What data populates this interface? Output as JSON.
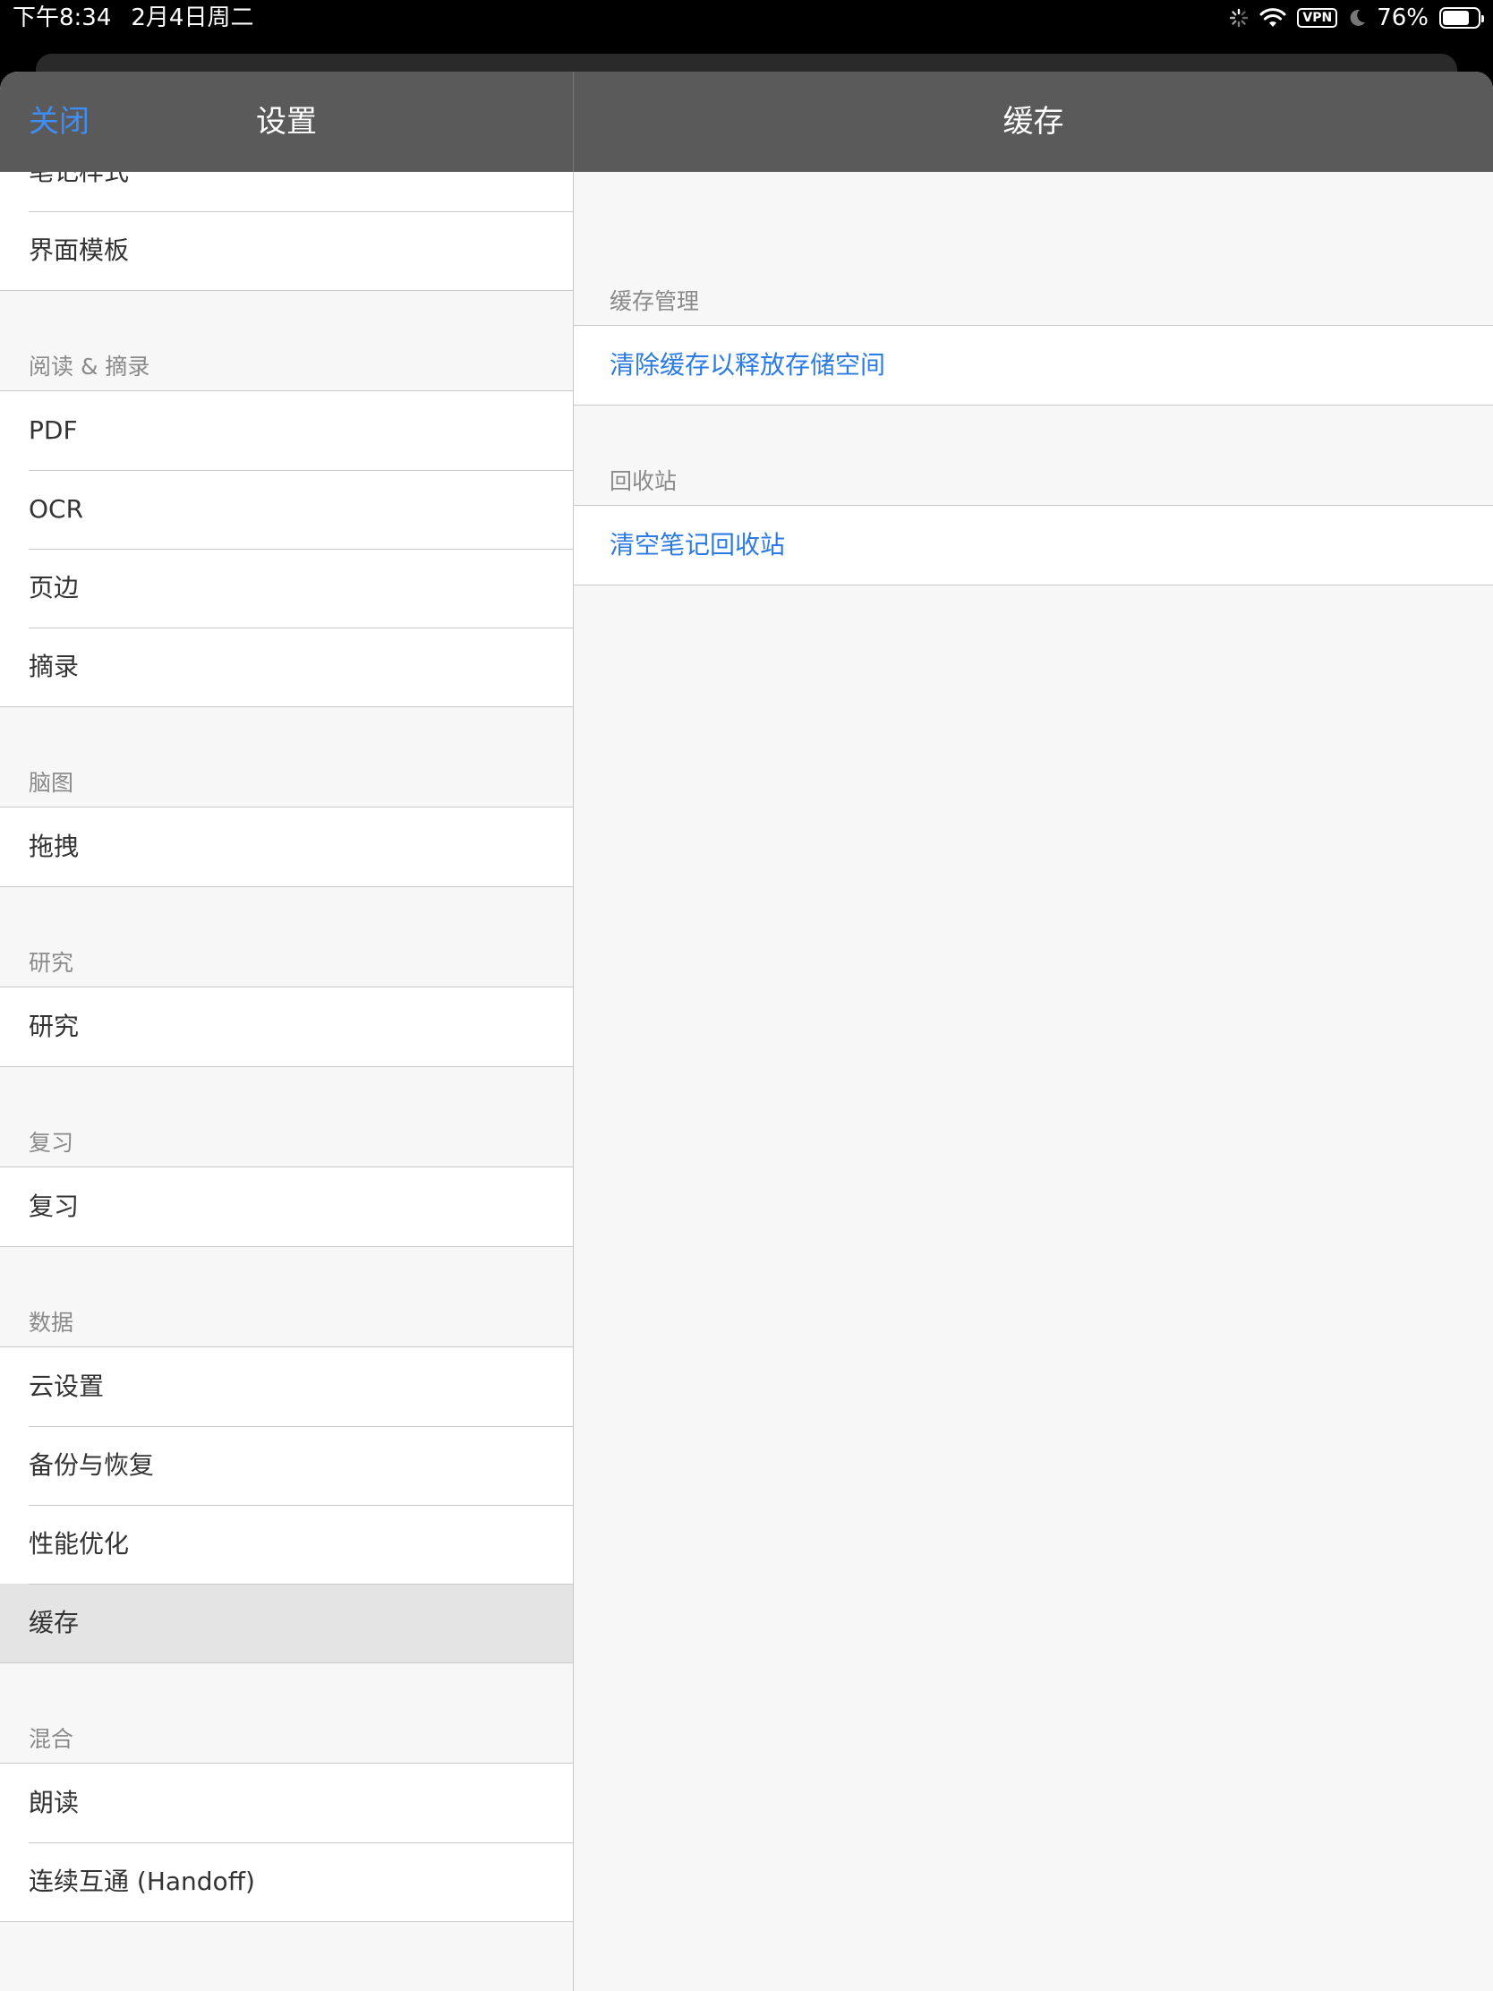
{
  "status_bar": {
    "time": "下午8:34",
    "date": "2月4日周二",
    "vpn": "VPN",
    "battery": "76%",
    "battery_level": 0.76
  },
  "nav": {
    "close_label": "关闭",
    "left_title": "设置",
    "right_title": "缓存"
  },
  "sidebar": {
    "top_items": [
      "笔记样式",
      "界面模板"
    ],
    "sections": [
      {
        "header": "阅读 & 摘录",
        "items": [
          "PDF",
          "OCR",
          "页边",
          "摘录"
        ]
      },
      {
        "header": "脑图",
        "items": [
          "拖拽"
        ]
      },
      {
        "header": "研究",
        "items": [
          "研究"
        ]
      },
      {
        "header": "复习",
        "items": [
          "复习"
        ]
      },
      {
        "header": "数据",
        "items": [
          "云设置",
          "备份与恢复",
          "性能优化",
          "缓存"
        ]
      },
      {
        "header": "混合",
        "items": [
          "朗读",
          "连续互通 (Handoff)"
        ]
      }
    ],
    "selected_item": "缓存"
  },
  "detail": {
    "sections": [
      {
        "header": "缓存管理",
        "actions": [
          "清除缓存以释放存储空间"
        ]
      },
      {
        "header": "回收站",
        "actions": [
          "清空笔记回收站"
        ]
      }
    ]
  },
  "colors": {
    "accent": "#2c7be5",
    "nav_close": "#3f8df5",
    "nav_bar": "#5a5a5a",
    "selected_row": "#e4e4e4"
  }
}
